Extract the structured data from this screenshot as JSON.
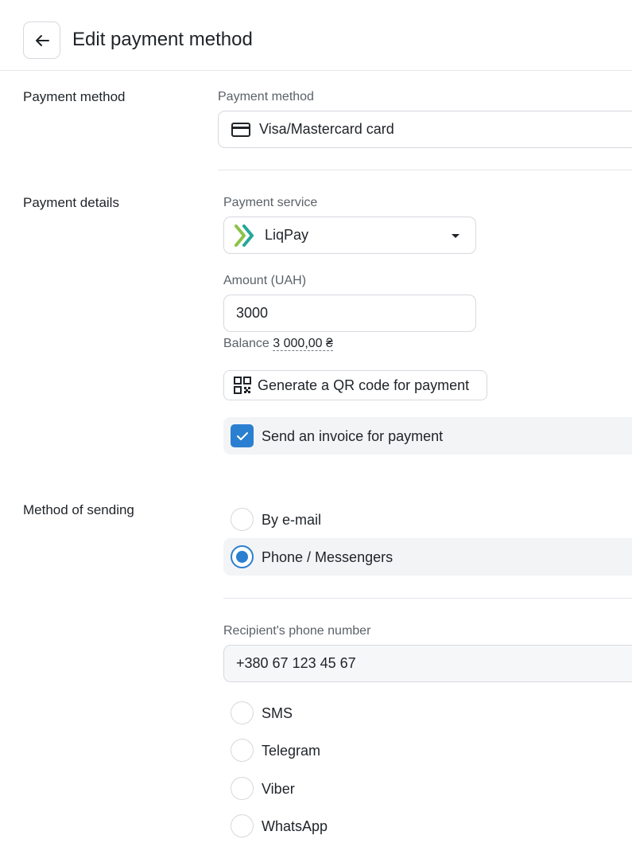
{
  "header": {
    "title": "Edit payment method",
    "back_icon": "arrow-left-icon"
  },
  "payment_method_section": {
    "label": "Payment method",
    "field_label": "Payment method",
    "value": "Visa/Mastercard card",
    "icon": "credit-card-icon"
  },
  "payment_details_section": {
    "label": "Payment details",
    "service_label": "Payment service",
    "service_value": "LiqPay",
    "service_icon": "liqpay-logo-icon",
    "amount_label": "Amount (UAH)",
    "amount_value": "3000",
    "balance_label": "Balance",
    "balance_value": "3 000,00 ₴",
    "qr_button_label": "Generate a QR code for payment",
    "invoice_checkbox_label": "Send an invoice for payment",
    "invoice_checked": true
  },
  "sending_section": {
    "label": "Method of sending",
    "options": [
      {
        "label": "By e-mail",
        "selected": false
      },
      {
        "label": "Phone / Messengers",
        "selected": true
      }
    ],
    "phone_label": "Recipient's phone number",
    "phone_value": "+380 67 123 45 67",
    "channels": [
      {
        "label": "SMS",
        "selected": false
      },
      {
        "label": "Telegram",
        "selected": false
      },
      {
        "label": "Viber",
        "selected": false
      },
      {
        "label": "WhatsApp",
        "selected": false
      }
    ]
  },
  "colors": {
    "accent": "#2b7fd0",
    "row_highlight": "#f3f4f6",
    "liqpay_green": "#8bc34a",
    "liqpay_teal": "#26a69a"
  }
}
